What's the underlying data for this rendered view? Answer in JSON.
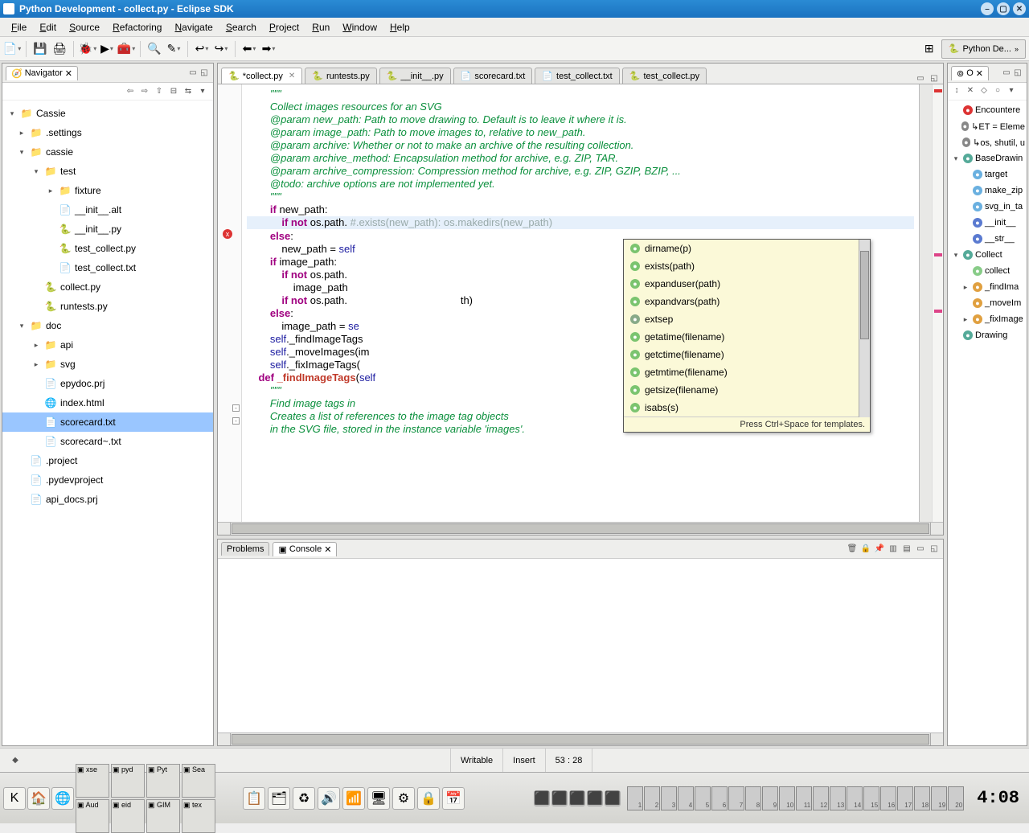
{
  "title": "Python Development - collect.py - Eclipse SDK",
  "menu": [
    "File",
    "Edit",
    "Source",
    "Refactoring",
    "Navigate",
    "Search",
    "Project",
    "Run",
    "Window",
    "Help"
  ],
  "perspective": "Python De...",
  "navigator": {
    "label": "Navigator",
    "tree": [
      {
        "d": 0,
        "tw": "▾",
        "icon": "folder",
        "label": "Cassie"
      },
      {
        "d": 1,
        "tw": "▸",
        "icon": "folder",
        "label": ".settings"
      },
      {
        "d": 1,
        "tw": "▾",
        "icon": "folder",
        "label": "cassie"
      },
      {
        "d": 2,
        "tw": "▾",
        "icon": "folder",
        "label": "test"
      },
      {
        "d": 3,
        "tw": "▸",
        "icon": "folder",
        "label": "fixture"
      },
      {
        "d": 3,
        "tw": "",
        "icon": "txtfile",
        "label": "__init__.alt"
      },
      {
        "d": 3,
        "tw": "",
        "icon": "pyfile",
        "label": "__init__.py"
      },
      {
        "d": 3,
        "tw": "",
        "icon": "pyfile",
        "label": "test_collect.py"
      },
      {
        "d": 3,
        "tw": "",
        "icon": "txtfile",
        "label": "test_collect.txt"
      },
      {
        "d": 2,
        "tw": "",
        "icon": "pyfile",
        "label": "collect.py"
      },
      {
        "d": 2,
        "tw": "",
        "icon": "pyfile",
        "label": "runtests.py"
      },
      {
        "d": 1,
        "tw": "▾",
        "icon": "folder",
        "label": "doc"
      },
      {
        "d": 2,
        "tw": "▸",
        "icon": "folder",
        "label": "api"
      },
      {
        "d": 2,
        "tw": "▸",
        "icon": "folder",
        "label": "svg"
      },
      {
        "d": 2,
        "tw": "",
        "icon": "txtfile",
        "label": "epydoc.prj"
      },
      {
        "d": 2,
        "tw": "",
        "icon": "html",
        "label": "index.html"
      },
      {
        "d": 2,
        "tw": "",
        "icon": "txtfile",
        "label": "scorecard.txt",
        "selected": true
      },
      {
        "d": 2,
        "tw": "",
        "icon": "txtfile",
        "label": "scorecard~.txt"
      },
      {
        "d": 1,
        "tw": "",
        "icon": "txtfile",
        "label": ".project"
      },
      {
        "d": 1,
        "tw": "",
        "icon": "txtfile",
        "label": ".pydevproject"
      },
      {
        "d": 1,
        "tw": "",
        "icon": "txtfile",
        "label": "api_docs.prj"
      }
    ]
  },
  "editor_tabs": [
    {
      "label": "*collect.py",
      "active": true,
      "icon": "py"
    },
    {
      "label": "runtests.py",
      "icon": "py"
    },
    {
      "label": "__init__.py",
      "icon": "py"
    },
    {
      "label": "scorecard.txt",
      "icon": "txt"
    },
    {
      "label": "test_collect.txt",
      "icon": "txt"
    },
    {
      "label": "test_collect.py",
      "icon": "py"
    }
  ],
  "code": {
    "lines": [
      {
        "t": "doc",
        "txt": "        \"\"\""
      },
      {
        "t": "doc",
        "txt": "        Collect images resources for an SVG"
      },
      {
        "t": "doc",
        "txt": ""
      },
      {
        "t": "doc",
        "txt": "        @param new_path: Path to move drawing to. Default is to leave it where it is."
      },
      {
        "t": "doc",
        "txt": "        @param image_path: Path to move images to, relative to new_path."
      },
      {
        "t": "doc",
        "txt": "        @param archive: Whether or not to make an archive of the resulting collection."
      },
      {
        "t": "doc",
        "txt": "        @param archive_method: Encapsulation method for archive, e.g. ZIP, TAR."
      },
      {
        "t": "doc",
        "txt": "        @param archive_compression: Compression method for archive, e.g. ZIP, GZIP, BZIP, ..."
      },
      {
        "t": "doc",
        "txt": "        @todo: archive options are not implemented yet."
      },
      {
        "t": "doc",
        "txt": "        \"\"\""
      },
      {
        "t": "code",
        "html": "        <span class='kw'>if</span> new_path:"
      },
      {
        "t": "cur",
        "html": "            <span class='kw'>if not</span> os.path.<span class='cmt'> #.exists(new_path): os.makedirs(new_path)</span>"
      },
      {
        "t": "code",
        "html": "        <span class='kw'>else</span>:"
      },
      {
        "t": "code",
        "html": "            new_path = <span class='self'>self</span>"
      },
      {
        "t": "code",
        "html": "        <span class='kw'>if</span> image_path:"
      },
      {
        "t": "code",
        "html": "            <span class='kw'>if not</span> os.path."
      },
      {
        "t": "code",
        "html": "                image_path"
      },
      {
        "t": "code",
        "html": "            <span class='kw'>if not</span> os.path.                                       th)"
      },
      {
        "t": "code",
        "html": "        <span class='kw'>else</span>:"
      },
      {
        "t": "code",
        "html": "            image_path = <span class='self'>se</span>"
      },
      {
        "t": "code",
        "html": "        <span class='self'>self</span>._findImageTags"
      },
      {
        "t": "code",
        "html": "        <span class='self'>self</span>._moveImages(im"
      },
      {
        "t": "code",
        "html": "        <span class='self'>self</span>._fixImageTags("
      },
      {
        "t": "code",
        "txt": ""
      },
      {
        "t": "code",
        "html": "    <span class='kw'>def</span> <span class='def-name'>_findImageTags</span>(<span class='self'>self</span>"
      },
      {
        "t": "doc",
        "txt": "        \"\"\""
      },
      {
        "t": "doc",
        "txt": "        Find image tags in"
      },
      {
        "t": "doc",
        "txt": ""
      },
      {
        "t": "doc",
        "txt": "        Creates a list of references to the image tag objects"
      },
      {
        "t": "doc",
        "txt": "        in the SVG file, stored in the instance variable 'images'."
      }
    ]
  },
  "popup": {
    "items": [
      {
        "label": "dirname(p)",
        "k": "m"
      },
      {
        "label": "exists(path)",
        "k": "m"
      },
      {
        "label": "expanduser(path)",
        "k": "m"
      },
      {
        "label": "expandvars(path)",
        "k": "m"
      },
      {
        "label": "extsep",
        "k": "a"
      },
      {
        "label": "getatime(filename)",
        "k": "m"
      },
      {
        "label": "getctime(filename)",
        "k": "m"
      },
      {
        "label": "getmtime(filename)",
        "k": "m"
      },
      {
        "label": "getsize(filename)",
        "k": "m"
      },
      {
        "label": "isabs(s)",
        "k": "m"
      }
    ],
    "footer": "Press Ctrl+Space for templates."
  },
  "outline": {
    "label": "O",
    "items": [
      {
        "k": "err",
        "label": "Encountere",
        "d": 0
      },
      {
        "k": "imp",
        "label": "ET = Eleme",
        "d": 0,
        "pre": "↳"
      },
      {
        "k": "imp",
        "label": "os, shutil, u",
        "d": 0,
        "pre": "↳"
      },
      {
        "k": "cls",
        "label": "BaseDrawin",
        "d": 0,
        "tw": "▾"
      },
      {
        "k": "fld",
        "label": "target",
        "d": 1
      },
      {
        "k": "fld",
        "label": "make_zip",
        "d": 1
      },
      {
        "k": "fld",
        "label": "svg_in_ta",
        "d": 1
      },
      {
        "k": "tri",
        "label": "__init__",
        "d": 1
      },
      {
        "k": "tri",
        "label": "__str__",
        "d": 1
      },
      {
        "k": "cls",
        "label": "Collect",
        "d": 0,
        "tw": "▾"
      },
      {
        "k": "meth",
        "label": "collect",
        "d": 1
      },
      {
        "k": "pri",
        "label": "_findIma",
        "d": 1,
        "tw": "▸"
      },
      {
        "k": "pri",
        "label": "_moveIm",
        "d": 1
      },
      {
        "k": "pri",
        "label": "_fixImage",
        "d": 1,
        "tw": "▸"
      },
      {
        "k": "cls",
        "label": "Drawing",
        "d": 0
      }
    ]
  },
  "console_tabs": [
    "Problems",
    "Console"
  ],
  "status": {
    "writable": "Writable",
    "insert": "Insert",
    "pos": "53 : 28"
  },
  "taskbar": {
    "tasks": [
      "xse",
      "pyd",
      "Pyt",
      "Sea",
      "Aud",
      "eid",
      "GIM",
      "tex"
    ],
    "pager": [
      "1",
      "2",
      "3",
      "4",
      "5",
      "6",
      "7",
      "8",
      "9",
      "10",
      "11",
      "12",
      "13",
      "14",
      "15",
      "16",
      "17",
      "18",
      "19",
      "20"
    ],
    "clock": "4:08"
  }
}
